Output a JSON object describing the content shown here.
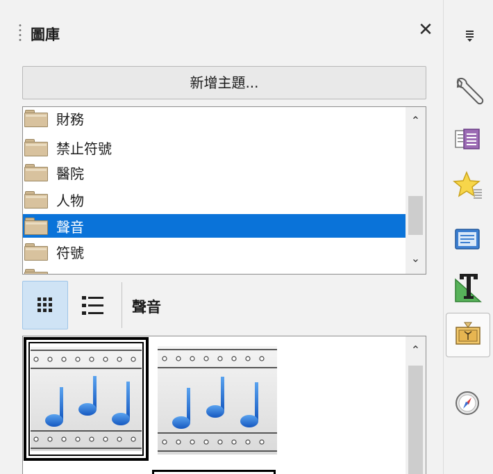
{
  "panel": {
    "title": "圖庫",
    "new_theme_button": "新增主題...",
    "current_theme": "聲音"
  },
  "theme_list": {
    "items": [
      {
        "label": "財務",
        "selected": false
      },
      {
        "label": "禁止符號",
        "selected": false
      },
      {
        "label": "醫院",
        "selected": false
      },
      {
        "label": "人物",
        "selected": false
      },
      {
        "label": "聲音",
        "selected": true
      },
      {
        "label": "符號",
        "selected": false
      }
    ]
  },
  "icons": {
    "close": "close-icon",
    "icon_view": "grid-view-icon",
    "detail_view": "list-view-icon",
    "scroll_up": "chevron-up-icon",
    "scroll_down": "chevron-down-icon"
  },
  "sidebar": {
    "buttons": [
      {
        "name": "sidebar-menu-icon",
        "active": false
      },
      {
        "name": "properties-wrench-icon",
        "active": false
      },
      {
        "name": "page-deck-icon",
        "active": false
      },
      {
        "name": "styles-star-icon",
        "active": false
      },
      {
        "name": "page-icon",
        "active": false
      },
      {
        "name": "fontwork-icon",
        "active": false
      },
      {
        "name": "gallery-icon",
        "active": true
      },
      {
        "name": "navigator-compass-icon",
        "active": false
      }
    ]
  },
  "colors": {
    "selection": "#0a73d9",
    "active_view": "#cfe3f5",
    "note_blue": "#1f6fd0"
  }
}
